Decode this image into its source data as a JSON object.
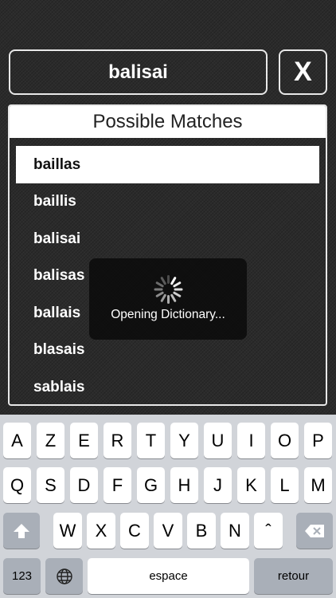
{
  "search": {
    "query": "balisai",
    "clear_label": "X"
  },
  "matches": {
    "header": "Possible Matches",
    "items": [
      "baillas",
      "baillis",
      "balisai",
      "balisas",
      "ballais",
      "blasais",
      "sablais"
    ]
  },
  "hud": {
    "label": "Opening Dictionary..."
  },
  "keyboard": {
    "row1": [
      "A",
      "Z",
      "E",
      "R",
      "T",
      "Y",
      "U",
      "I",
      "O",
      "P"
    ],
    "row2": [
      "Q",
      "S",
      "D",
      "F",
      "G",
      "H",
      "J",
      "K",
      "L",
      "M"
    ],
    "row3": [
      "W",
      "X",
      "C",
      "V",
      "B",
      "N",
      "ˆ"
    ],
    "numbers_label": "123",
    "space_label": "espace",
    "return_label": "retour",
    "shift_icon": "shift-icon",
    "backspace_icon": "backspace-icon",
    "globe_icon": "globe-icon"
  },
  "colors": {
    "background": "#2b2b2b",
    "keyboard": "#d1d4d9",
    "selected_row": "#ffffff"
  }
}
